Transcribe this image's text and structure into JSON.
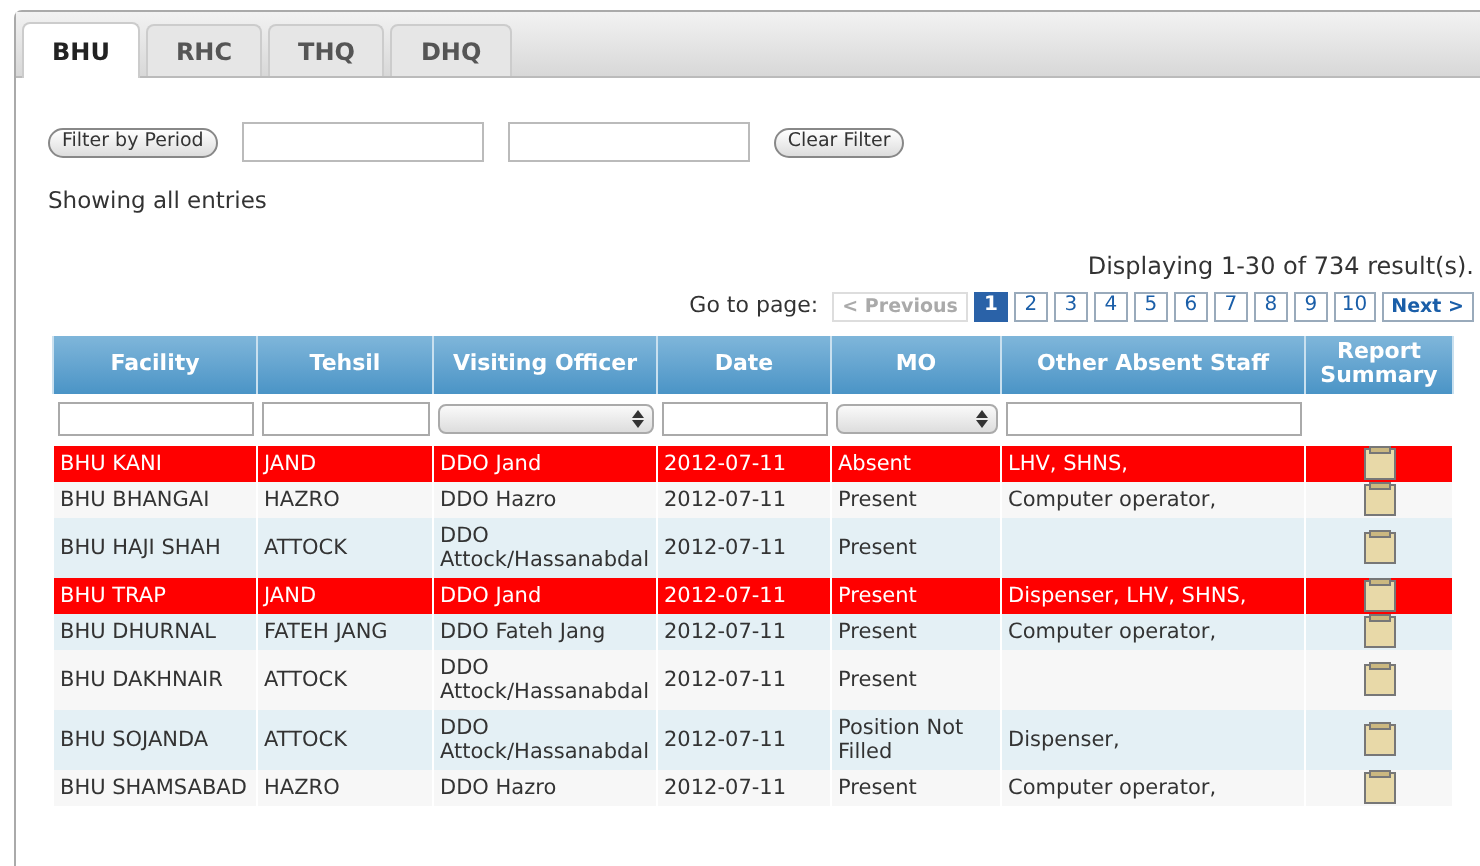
{
  "tabs": [
    {
      "label": "BHU",
      "selected": true
    },
    {
      "label": "RHC",
      "selected": false
    },
    {
      "label": "THQ",
      "selected": false
    },
    {
      "label": "DHQ",
      "selected": false
    }
  ],
  "filter": {
    "button": "Filter by Period",
    "clear_button": "Clear Filter"
  },
  "status": "Showing all entries",
  "result_count": "Displaying 1-30 of 734 result(s).",
  "pagination": {
    "label": "Go to page:",
    "previous": {
      "label": "< Previous",
      "disabled": true
    },
    "pages": [
      {
        "label": "1",
        "selected": true
      },
      {
        "label": "2",
        "selected": false
      },
      {
        "label": "3",
        "selected": false
      },
      {
        "label": "4",
        "selected": false
      },
      {
        "label": "5",
        "selected": false
      },
      {
        "label": "6",
        "selected": false
      },
      {
        "label": "7",
        "selected": false
      },
      {
        "label": "8",
        "selected": false
      },
      {
        "label": "9",
        "selected": false
      },
      {
        "label": "10",
        "selected": false
      }
    ],
    "next": {
      "label": "Next >",
      "disabled": false
    }
  },
  "table": {
    "columns": [
      {
        "label": "Facility",
        "kind": "text"
      },
      {
        "label": "Tehsil",
        "kind": "text"
      },
      {
        "label": "Visiting Officer",
        "kind": "select"
      },
      {
        "label": "Date",
        "kind": "text"
      },
      {
        "label": "MO",
        "kind": "select"
      },
      {
        "label": "Other Absent Staff",
        "kind": "text"
      },
      {
        "label": "Report Summary",
        "kind": "none"
      }
    ],
    "rows": [
      {
        "facility": "BHU KANI",
        "tehsil": "JAND",
        "officer": "DDO Jand",
        "date": "2012-07-11",
        "mo": "Absent",
        "staff": "LHV, SHNS,",
        "flagged": true
      },
      {
        "facility": "BHU BHANGAI",
        "tehsil": "HAZRO",
        "officer": "DDO Hazro",
        "date": "2012-07-11",
        "mo": "Present",
        "staff": "Computer operator,",
        "flagged": false
      },
      {
        "facility": "BHU HAJI SHAH",
        "tehsil": "ATTOCK",
        "officer": "DDO Attock/Hassanabdal",
        "date": "2012-07-11",
        "mo": "Present",
        "staff": "",
        "flagged": false
      },
      {
        "facility": "BHU TRAP",
        "tehsil": "JAND",
        "officer": "DDO Jand",
        "date": "2012-07-11",
        "mo": "Present",
        "staff": "Dispenser, LHV, SHNS,",
        "flagged": true
      },
      {
        "facility": "BHU DHURNAL",
        "tehsil": "FATEH JANG",
        "officer": "DDO Fateh Jang",
        "date": "2012-07-11",
        "mo": "Present",
        "staff": "Computer operator,",
        "flagged": false
      },
      {
        "facility": "BHU DAKHNAIR",
        "tehsil": "ATTOCK",
        "officer": "DDO Attock/Hassanabdal",
        "date": "2012-07-11",
        "mo": "Present",
        "staff": "",
        "flagged": false
      },
      {
        "facility": "BHU SOJANDA",
        "tehsil": "ATTOCK",
        "officer": "DDO Attock/Hassanabdal",
        "date": "2012-07-11",
        "mo": "Position Not Filled",
        "staff": "Dispenser,",
        "flagged": false
      },
      {
        "facility": "BHU SHAMSABAD",
        "tehsil": "HAZRO",
        "officer": "DDO Hazro",
        "date": "2012-07-11",
        "mo": "Present",
        "staff": "Computer operator,",
        "flagged": false
      }
    ]
  }
}
